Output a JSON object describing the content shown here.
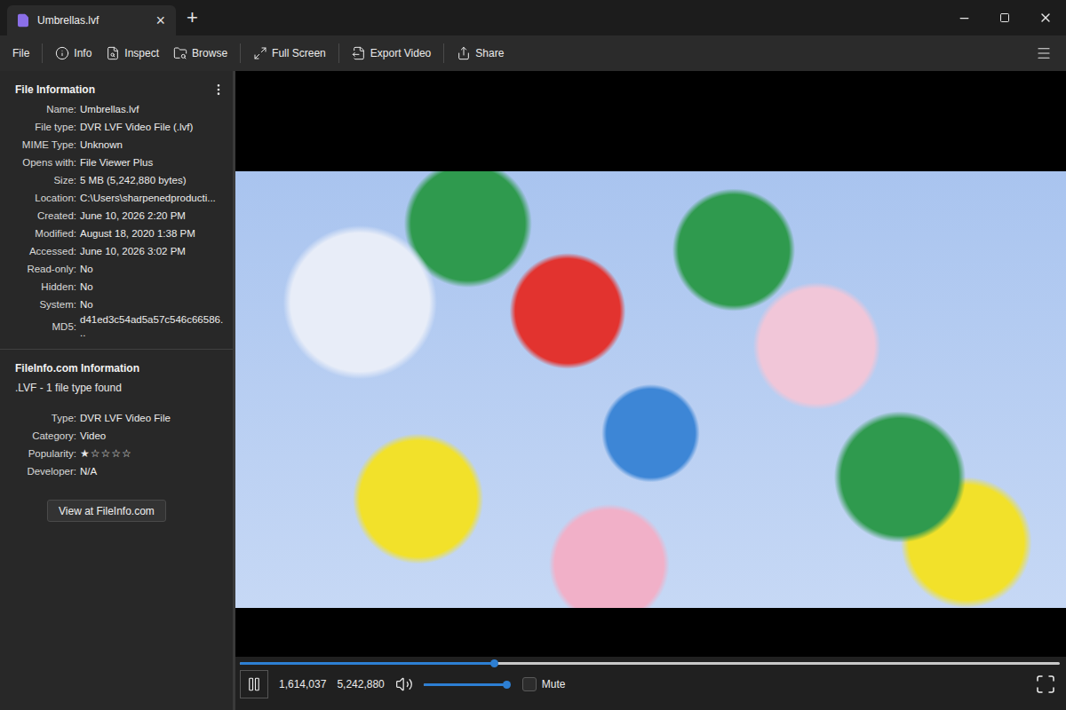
{
  "window": {
    "title": "Umbrellas.lvf",
    "tab_close": "×",
    "new_tab": "+"
  },
  "toolbar": {
    "groups": [
      [
        "File"
      ],
      [
        "Info",
        "Inspect",
        "Browse"
      ],
      [
        "Full Screen"
      ],
      [
        "Export Video"
      ],
      [
        "Share"
      ]
    ]
  },
  "file_info": {
    "title": "File Information",
    "rows": [
      {
        "label": "Name:",
        "value": "Umbrellas.lvf"
      },
      {
        "label": "File type:",
        "value": "DVR LVF Video File (.lvf)"
      },
      {
        "label": "MIME Type:",
        "value": "Unknown"
      },
      {
        "label": "Opens with:",
        "value": "File Viewer Plus"
      },
      {
        "label": "Size:",
        "value": "5 MB (5,242,880 bytes)"
      },
      {
        "label": "Location:",
        "value": "C:\\Users\\sharpenedproducti..."
      },
      {
        "label": "Created:",
        "value": "June 10, 2026 2:20 PM"
      },
      {
        "label": "Modified:",
        "value": "August 18, 2020 1:38 PM"
      },
      {
        "label": "Accessed:",
        "value": "June 10, 2026 3:02 PM"
      },
      {
        "label": "Read-only:",
        "value": "No"
      },
      {
        "label": "Hidden:",
        "value": "No"
      },
      {
        "label": "System:",
        "value": "No"
      },
      {
        "label": "MD5:",
        "value": "d41ed3c54ad5a57c546c66586..."
      }
    ]
  },
  "fileinfo_com": {
    "title": "FileInfo.com Information",
    "subtitle": ".LVF - 1 file type found",
    "rows": [
      {
        "kind": "text",
        "label": "Type:",
        "value": "DVR LVF Video File"
      },
      {
        "kind": "text",
        "label": "Category:",
        "value": "Video"
      },
      {
        "kind": "stars",
        "label": "Popularity:",
        "stars": 1,
        "max_stars": 5,
        "filled_glyph": "★",
        "empty_glyph": "☆"
      },
      {
        "kind": "text",
        "label": "Developer:",
        "value": "N/A"
      }
    ],
    "button": "View at FileInfo.com"
  },
  "player": {
    "playing": true,
    "progress": {
      "level": 0.31
    },
    "position": "1,614,037",
    "total": "5,242,880",
    "volume": {
      "level": 1.0
    },
    "mute": {
      "label": "Mute",
      "checked": false
    }
  }
}
